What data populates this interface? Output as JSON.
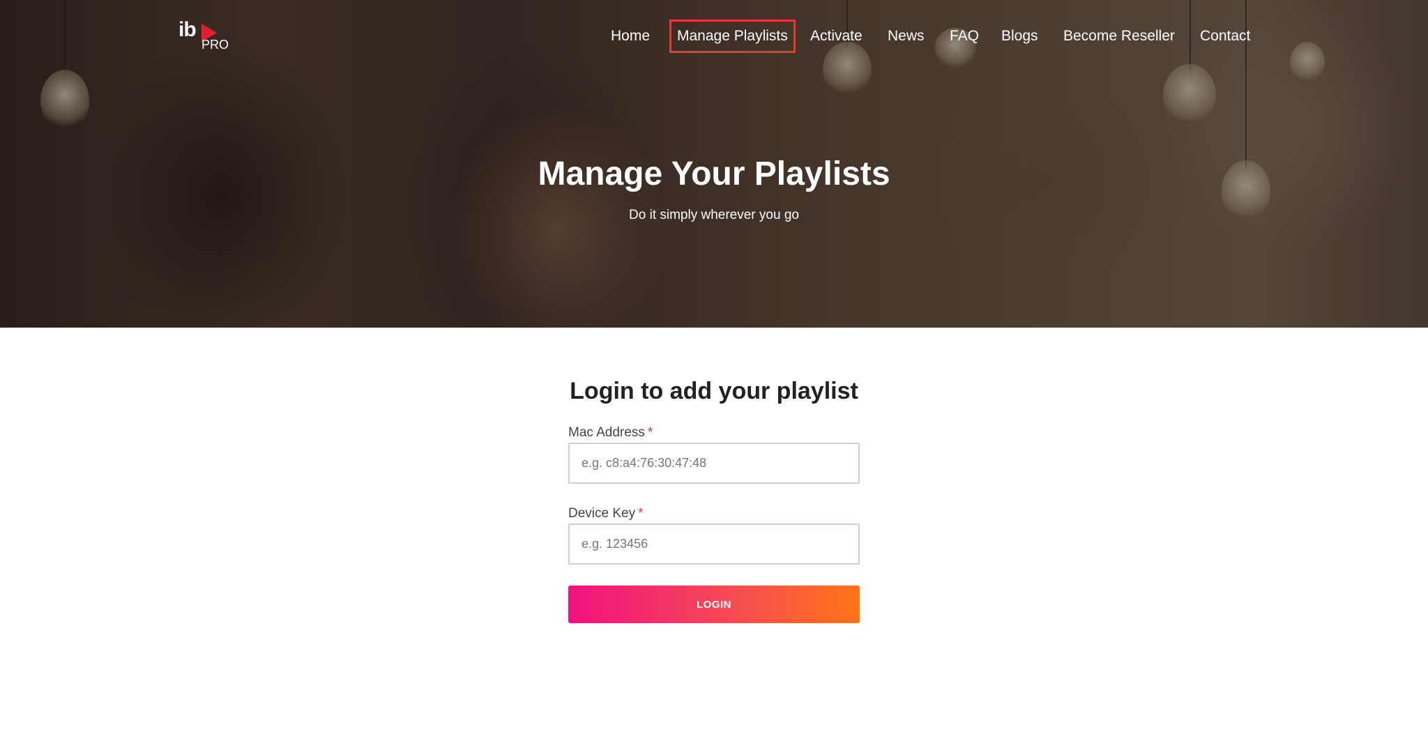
{
  "brand": {
    "logo_ib": "ib",
    "logo_pro": "PRO",
    "accent_color": "#e53935",
    "play_color": "#e0202e"
  },
  "nav": {
    "items": [
      {
        "label": "Home"
      },
      {
        "label": "Manage Playlists",
        "highlighted": true
      },
      {
        "label": "Activate"
      },
      {
        "label": "News"
      },
      {
        "label": "FAQ"
      },
      {
        "label": "Blogs"
      },
      {
        "label": "Become Reseller"
      },
      {
        "label": "Contact"
      }
    ]
  },
  "hero": {
    "title": "Manage Your Playlists",
    "subtitle": "Do it simply wherever you go"
  },
  "login": {
    "title": "Login to add your playlist",
    "mac_label": "Mac Address",
    "mac_placeholder": "e.g. c8:a4:76:30:47:48",
    "mac_value": "",
    "key_label": "Device Key",
    "key_placeholder": "e.g. 123456",
    "key_value": "",
    "required_mark": "*",
    "button_label": "LOGIN",
    "button_gradient": [
      "#f0127f",
      "#f64a55",
      "#ff7417"
    ]
  }
}
